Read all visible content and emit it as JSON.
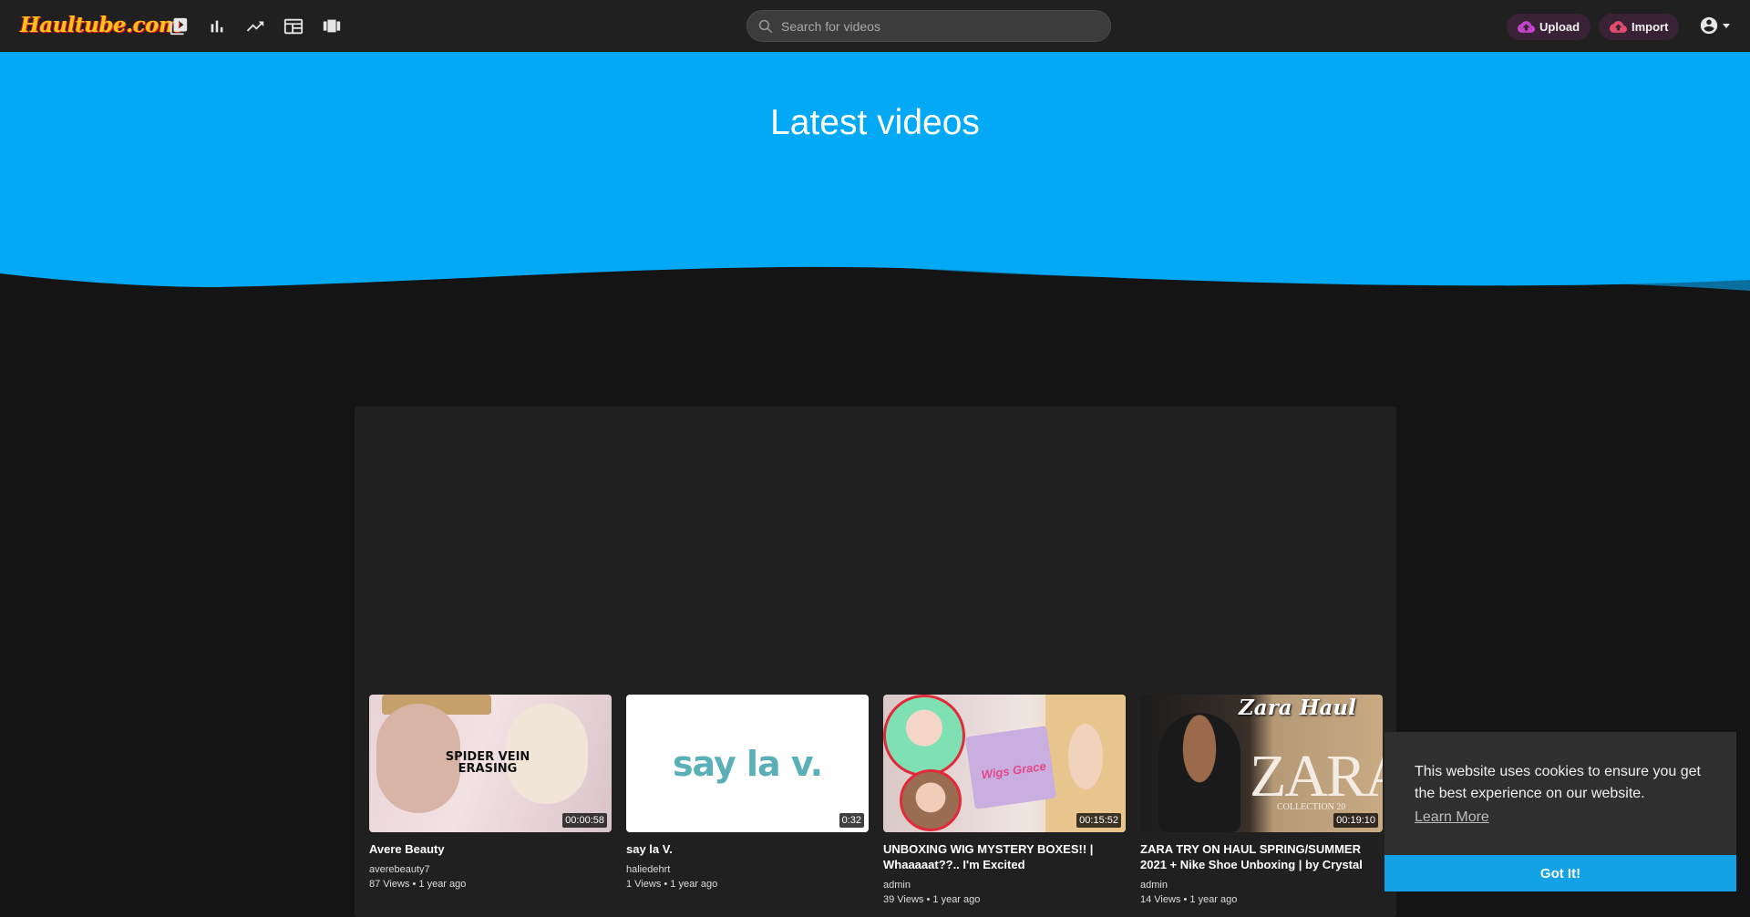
{
  "header": {
    "logo_text": "Haultube.com",
    "nav_icons": [
      "videos-icon",
      "charts-icon",
      "trending-icon",
      "categories-icon",
      "carousel-icon"
    ],
    "search_placeholder": "Search for videos",
    "upload_label": "Upload",
    "import_label": "Import"
  },
  "hero": {
    "title": "Latest videos",
    "color": "#03a9f4"
  },
  "videos": [
    {
      "title": "Avere Beauty",
      "duration": "00:00:58",
      "thumb_text": "SPIDER VEIN ERASING",
      "user": "averebeauty7",
      "meta": "87 Views • 1 year ago"
    },
    {
      "title": "say la V.",
      "duration": "0:32",
      "thumb_text": "say la v.",
      "user": "haliedehrt",
      "meta": "1 Views • 1 year ago"
    },
    {
      "title": "UNBOXING WIG MYSTERY BOXES!! | Whaaaaat??.. I'm Excited",
      "duration": "00:15:52",
      "thumb_text": "Wigs Grace",
      "user": "admin",
      "meta": "39 Views • 1 year ago"
    },
    {
      "title": "ZARA TRY ON HAUL SPRING/SUMMER 2021 + Nike Shoe Unboxing | by Crystal",
      "duration": "00:19:10",
      "thumb_text": "Zara Haul",
      "thumb_logo": "ZARA",
      "thumb_sub": "COLLECTION 20",
      "user": "admin",
      "meta": "14 Views • 1 year ago"
    }
  ],
  "cookie": {
    "message": "This website uses cookies to ensure you get the best experience on our website.",
    "learn_more": "Learn More",
    "button": "Got It!"
  }
}
